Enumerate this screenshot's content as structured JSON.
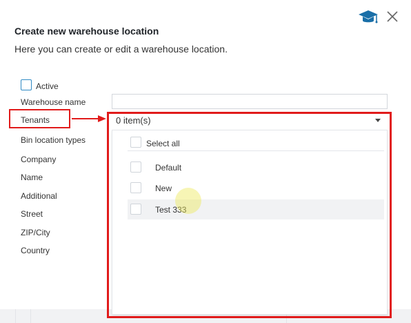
{
  "dialog": {
    "title": "Create new warehouse location",
    "subtitle": "Here you can create or edit a warehouse location."
  },
  "form": {
    "active_label": "Active",
    "active_checked": false,
    "labels": {
      "warehouse_name": "Warehouse name",
      "tenants": "Tenants",
      "bin_location_types": "Bin location types",
      "company": "Company",
      "name": "Name",
      "additional": "Additional",
      "street": "Street",
      "zip_city": "ZIP/City",
      "country": "Country"
    },
    "warehouse_name_value": "",
    "tenants_value": "0 item(s)"
  },
  "tenants_dropdown": {
    "select_all_label": "Select all",
    "options": [
      {
        "label": "Default",
        "checked": false
      },
      {
        "label": "New",
        "checked": false
      },
      {
        "label": "Test 333",
        "checked": false,
        "hovered": true
      }
    ]
  },
  "icons": {
    "help": "graduation-cap-icon",
    "close": "close-icon",
    "annotation_arrow": "arrow-right-icon"
  },
  "colors": {
    "accent": "#1a6fa8",
    "annotation": "#e11b1b",
    "hover_row": "#f1f2f4"
  }
}
